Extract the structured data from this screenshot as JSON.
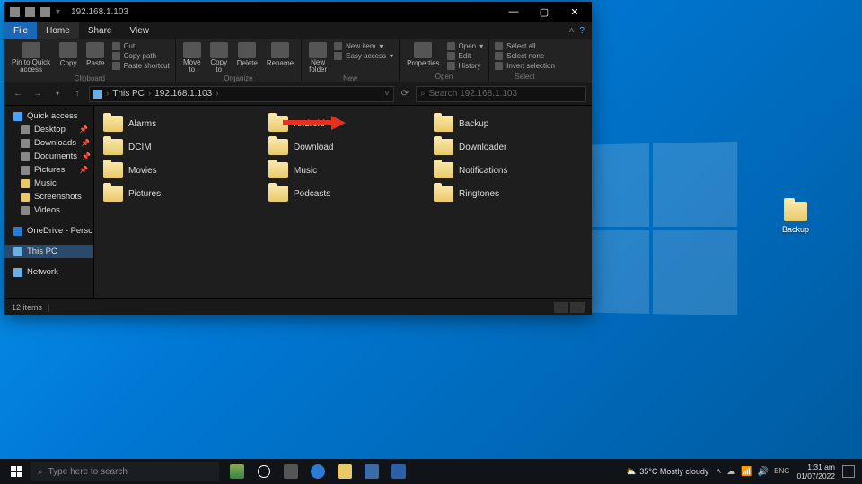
{
  "window": {
    "title": "192.168.1.103",
    "tabs": {
      "file": "File",
      "home": "Home",
      "share": "Share",
      "view": "View"
    }
  },
  "ribbon": {
    "clipboard": {
      "pin": "Pin to Quick\naccess",
      "copy": "Copy",
      "paste": "Paste",
      "cut": "Cut",
      "copypath": "Copy path",
      "pasteshort": "Paste shortcut",
      "label": "Clipboard"
    },
    "organize": {
      "move": "Move\nto",
      "copyto": "Copy\nto",
      "delete": "Delete",
      "rename": "Rename",
      "label": "Organize"
    },
    "new": {
      "folder": "New\nfolder",
      "item": "New item",
      "easy": "Easy access",
      "label": "New"
    },
    "open": {
      "props": "Properties",
      "open": "Open",
      "edit": "Edit",
      "history": "History",
      "label": "Open"
    },
    "select": {
      "all": "Select all",
      "none": "Select none",
      "inv": "Invert selection",
      "label": "Select"
    }
  },
  "address": {
    "root": "This PC",
    "path": "192.168.1.103"
  },
  "search": {
    "placeholder": "Search 192.168.1.103"
  },
  "nav": {
    "quick": "Quick access",
    "desktop": "Desktop",
    "downloads": "Downloads",
    "documents": "Documents",
    "pictures": "Pictures",
    "music": "Music",
    "screenshots": "Screenshots",
    "videos": "Videos",
    "onedrive": "OneDrive - Personal",
    "thispc": "This PC",
    "network": "Network"
  },
  "folders": [
    "Alarms",
    "Android",
    "Backup",
    "DCIM",
    "Download",
    "Downloader",
    "Movies",
    "Music",
    "Notifications",
    "Pictures",
    "Podcasts",
    "Ringtones"
  ],
  "status": {
    "count": "12 items"
  },
  "desktop": {
    "backup": "Backup"
  },
  "taskbar": {
    "search": "Type here to search",
    "weather": "35°C  Mostly cloudy",
    "time": "1:31 am",
    "date": "01/07/2022"
  }
}
